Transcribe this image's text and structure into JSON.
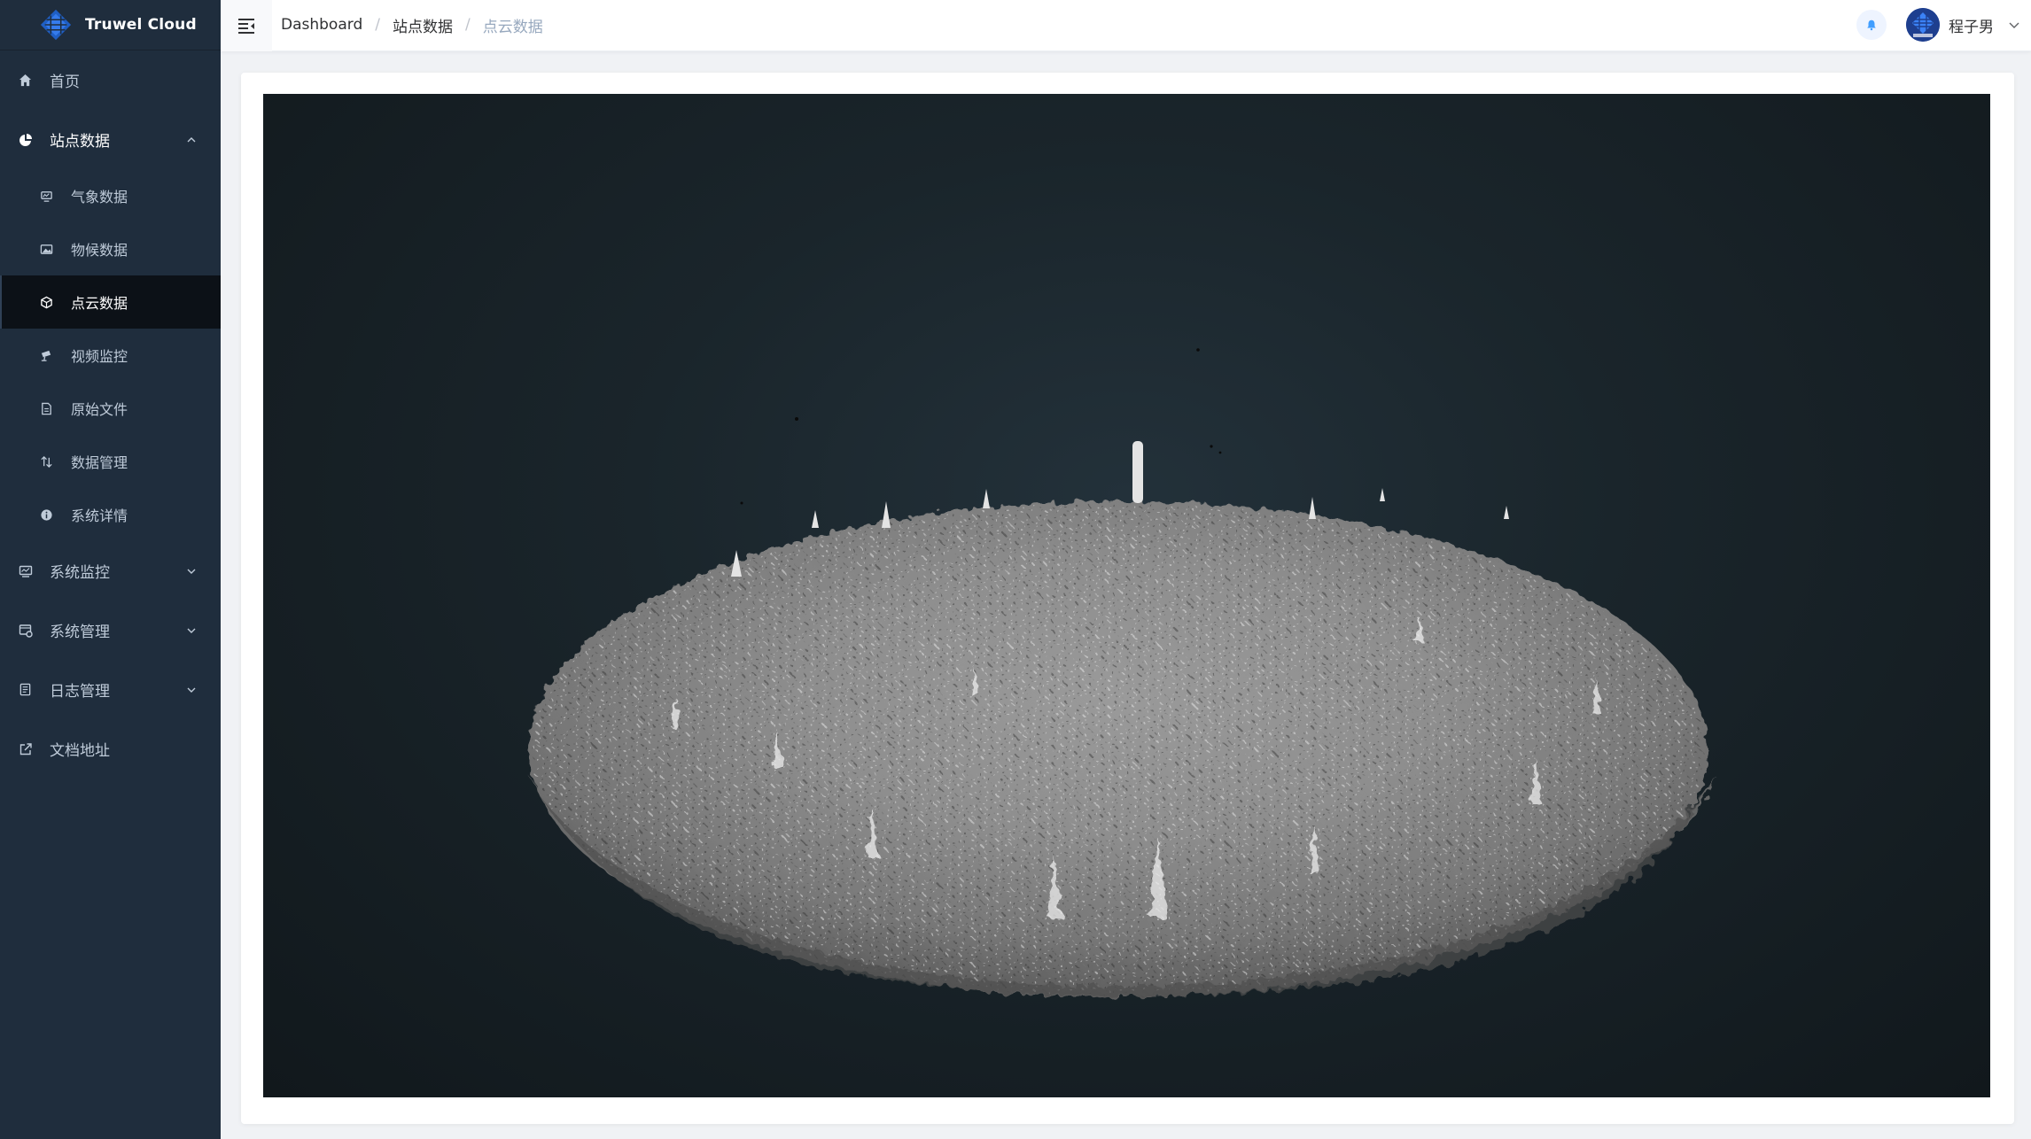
{
  "app": {
    "title": "Truwel Cloud"
  },
  "sidebar": {
    "items": [
      {
        "label": "首页",
        "icon": "home-icon"
      },
      {
        "label": "站点数据",
        "icon": "pie-chart-icon",
        "expanded": true,
        "children": [
          {
            "label": "气象数据",
            "icon": "monitor-icon"
          },
          {
            "label": "物候数据",
            "icon": "image-icon"
          },
          {
            "label": "点云数据",
            "icon": "cube-icon",
            "active": true
          },
          {
            "label": "视频监控",
            "icon": "camera-icon"
          },
          {
            "label": "原始文件",
            "icon": "file-icon"
          },
          {
            "label": "数据管理",
            "icon": "sort-icon"
          },
          {
            "label": "系统详情",
            "icon": "info-icon"
          }
        ]
      },
      {
        "label": "系统监控",
        "icon": "monitor-chart-icon",
        "expanded": false
      },
      {
        "label": "系统管理",
        "icon": "settings-window-icon",
        "expanded": false
      },
      {
        "label": "日志管理",
        "icon": "log-icon",
        "expanded": false
      },
      {
        "label": "文档地址",
        "icon": "external-link-icon"
      }
    ]
  },
  "header": {
    "breadcrumb": [
      "Dashboard",
      "站点数据",
      "点云数据"
    ],
    "username": "程子男"
  },
  "colors": {
    "sidebar_bg": "#1f2d3d",
    "sidebar_active_bg": "#0c1117",
    "viewer_bg": "#1a252b",
    "accent": "#409eff"
  }
}
